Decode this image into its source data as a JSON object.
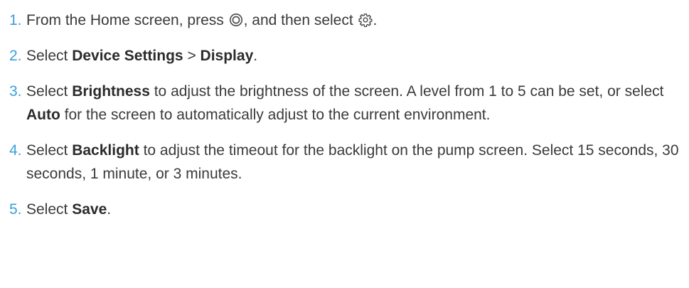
{
  "steps": [
    {
      "number": "1.",
      "parts": {
        "t1": "From the Home screen, press ",
        "icon_a": "menu-button-icon",
        "t2": ", and then select ",
        "icon_b": "settings-gear-icon",
        "t3": "."
      }
    },
    {
      "number": "2.",
      "parts": {
        "t1": "Select ",
        "b1": "Device Settings",
        "t2": " > ",
        "b2": "Display",
        "t3": "."
      }
    },
    {
      "number": "3.",
      "parts": {
        "t1": "Select ",
        "b1": "Brightness",
        "t2": " to adjust the brightness of the screen. A level from 1 to 5 can be set, or select ",
        "b2": "Auto",
        "t3": " for the screen to automatically adjust to the current environment."
      }
    },
    {
      "number": "4.",
      "parts": {
        "t1": "Select ",
        "b1": "Backlight",
        "t2": " to adjust the timeout for the backlight on the pump screen. Select 15 seconds, 30 seconds, 1 minute, or 3 minutes."
      }
    },
    {
      "number": "5.",
      "parts": {
        "t1": "Select ",
        "b1": "Save",
        "t2": "."
      }
    }
  ],
  "colors": {
    "step_number": "#3b9fd9",
    "text": "#3a3a3a"
  }
}
